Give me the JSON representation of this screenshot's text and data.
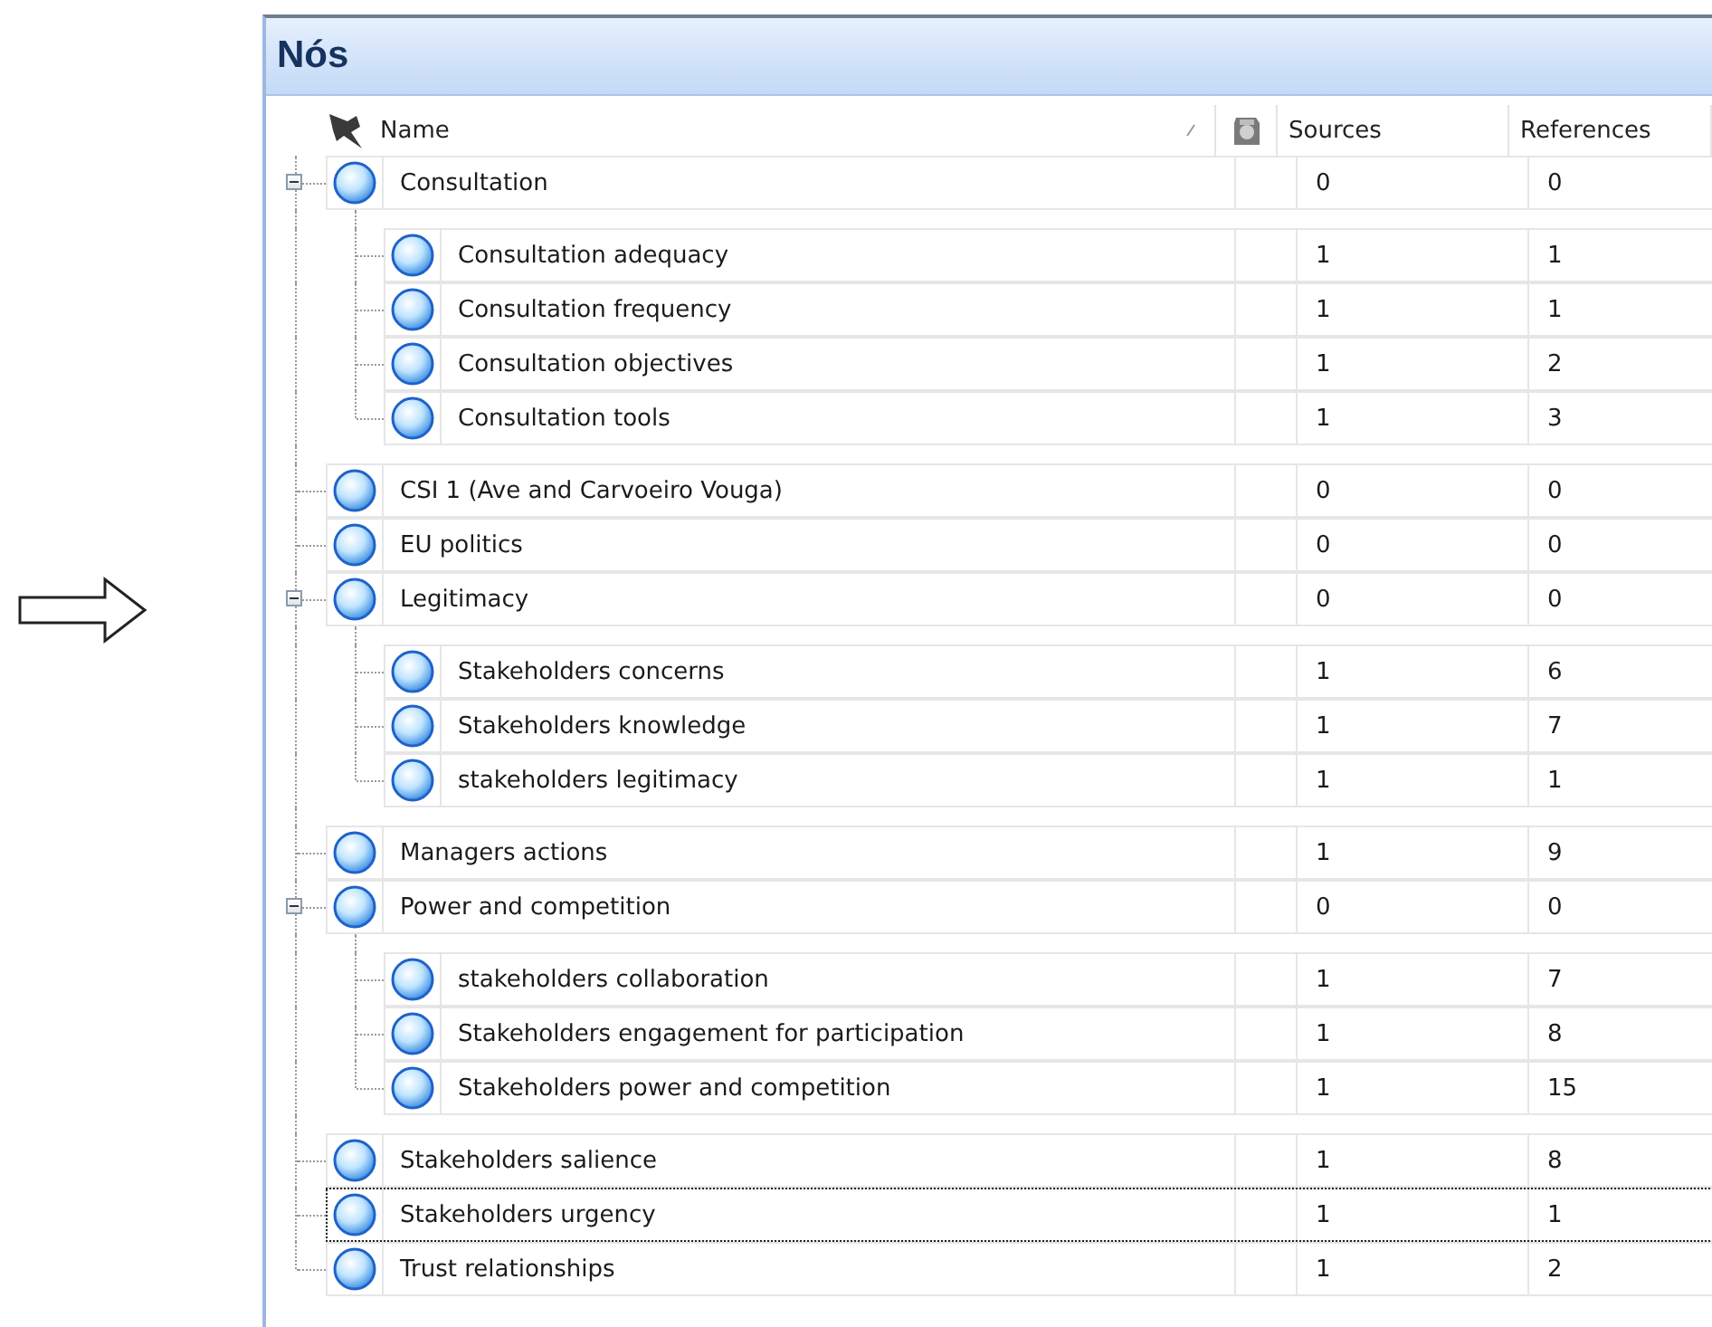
{
  "panel": {
    "title": "Nós"
  },
  "columns": [
    {
      "kind": "name",
      "label": "Name"
    },
    {
      "kind": "sources",
      "label": "Sources"
    },
    {
      "kind": "references",
      "label": "References"
    }
  ],
  "nodes": [
    {
      "name": "Consultation",
      "sources": "0",
      "references": "0",
      "expanded": true,
      "focused": false,
      "children": [
        {
          "name": "Consultation adequacy",
          "sources": "1",
          "references": "1",
          "focused": false
        },
        {
          "name": "Consultation frequency",
          "sources": "1",
          "references": "1",
          "focused": false
        },
        {
          "name": "Consultation objectives",
          "sources": "1",
          "references": "2",
          "focused": false
        },
        {
          "name": "Consultation tools",
          "sources": "1",
          "references": "3",
          "focused": false
        }
      ]
    },
    {
      "name": "CSI 1 (Ave and Carvoeiro Vouga)",
      "sources": "0",
      "references": "0",
      "focused": false
    },
    {
      "name": "EU politics",
      "sources": "0",
      "references": "0",
      "focused": false
    },
    {
      "name": "Legitimacy",
      "sources": "0",
      "references": "0",
      "expanded": true,
      "focused": false,
      "children": [
        {
          "name": "Stakeholders concerns",
          "sources": "1",
          "references": "6",
          "focused": false
        },
        {
          "name": "Stakeholders knowledge",
          "sources": "1",
          "references": "7",
          "focused": false
        },
        {
          "name": "stakeholders legitimacy",
          "sources": "1",
          "references": "1",
          "focused": false
        }
      ]
    },
    {
      "name": "Managers actions",
      "sources": "1",
      "references": "9",
      "focused": false
    },
    {
      "name": "Power and competition",
      "sources": "0",
      "references": "0",
      "expanded": true,
      "focused": false,
      "children": [
        {
          "name": "stakeholders collaboration",
          "sources": "1",
          "references": "7",
          "focused": false
        },
        {
          "name": "Stakeholders engagement for participation",
          "sources": "1",
          "references": "8",
          "focused": false
        },
        {
          "name": "Stakeholders power and competition",
          "sources": "1",
          "references": "15",
          "focused": false
        }
      ]
    },
    {
      "name": "Stakeholders salience",
      "sources": "1",
      "references": "8",
      "focused": false
    },
    {
      "name": "Stakeholders urgency",
      "sources": "1",
      "references": "1",
      "focused": true
    },
    {
      "name": "Trust relationships",
      "sources": "1",
      "references": "2",
      "focused": false
    }
  ]
}
